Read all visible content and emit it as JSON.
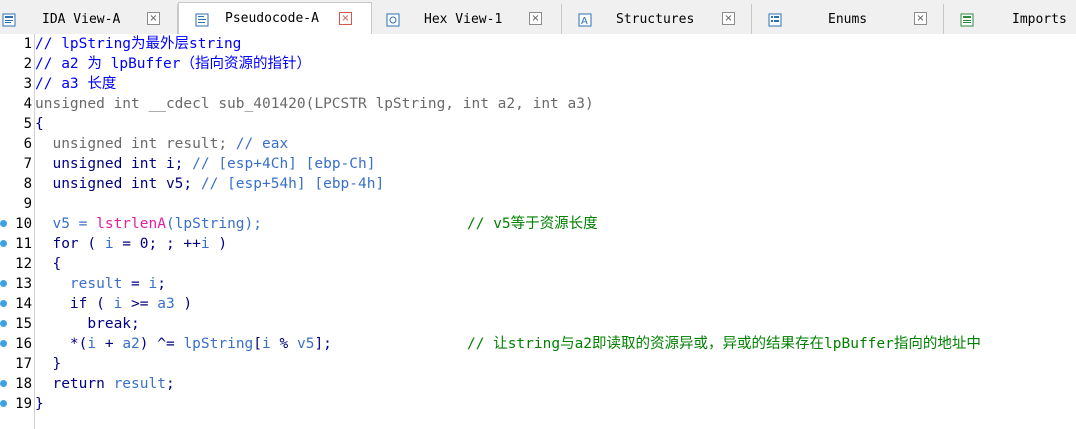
{
  "tabs": [
    {
      "label": "IDA View-A",
      "icon": "ida-view-icon",
      "active": false
    },
    {
      "label": "Pseudocode-A",
      "icon": "pseudocode-icon",
      "active": true
    },
    {
      "label": "Hex View-1",
      "icon": "hex-view-icon",
      "active": false
    },
    {
      "label": "Structures",
      "icon": "structures-icon",
      "active": false
    },
    {
      "label": "Enums",
      "icon": "enums-icon",
      "active": false
    },
    {
      "label": "Imports",
      "icon": "imports-icon",
      "active": false
    }
  ],
  "close_glyph": "×",
  "lines": {
    "l1": "// lpString为最外层string",
    "l2": "// a2 为 lpBuffer（指向资源的指针）",
    "l3": "// a3 长度",
    "l4": "unsigned int __cdecl sub_401420(LPCSTR lpString, int a2, int a3)",
    "l5": "{",
    "l6_a": "  unsigned int result; ",
    "l6_b": "// eax",
    "l7_a": "  unsigned int i; ",
    "l7_b": "// [esp+4Ch] [ebp-Ch]",
    "l8_a": "  unsigned int v5; ",
    "l8_b": "// [esp+54h] [ebp-4h]",
    "l10_a": "  v5 = ",
    "l10_fn": "lstrlenA",
    "l10_b": "(",
    "l10_c": "lpString",
    "l10_d": ");",
    "l10_cmt": "// v5等于资源长度",
    "l11_a": "  for ( ",
    "l11_b": "i",
    "l11_c": " = 0; ; ++",
    "l11_d": "i",
    "l11_e": " )",
    "l12": "  {",
    "l13_a": "    ",
    "l13_b": "result",
    "l13_c": " = ",
    "l13_d": "i",
    "l13_e": ";",
    "l14_a": "    if ( ",
    "l14_b": "i",
    "l14_c": " >= ",
    "l14_d": "a3",
    "l14_e": " )",
    "l15": "      break;",
    "l16_a": "    *(",
    "l16_b": "i",
    "l16_c": " + ",
    "l16_d": "a2",
    "l16_e": ") ^= ",
    "l16_f": "lpString",
    "l16_g": "[",
    "l16_h": "i",
    "l16_i": " % ",
    "l16_j": "v5",
    "l16_k": "];",
    "l16_cmt": "// 让string与a2即读取的资源异或，异或的结果存在lpBuffer指向的地址中",
    "l17": "  }",
    "l18_a": "  return ",
    "l18_b": "result",
    "l18_c": ";",
    "l19": "}"
  },
  "line_numbers": [
    "1",
    "2",
    "3",
    "4",
    "5",
    "6",
    "7",
    "8",
    "9",
    "10",
    "11",
    "12",
    "13",
    "14",
    "15",
    "16",
    "17",
    "18",
    "19"
  ],
  "colors": {
    "comment_green": "#008000",
    "keyword_navy": "#000080",
    "variable_blue": "#3a70c9",
    "function_magenta": "#e020a0",
    "breakpoint_blue": "#3fa0e0"
  }
}
